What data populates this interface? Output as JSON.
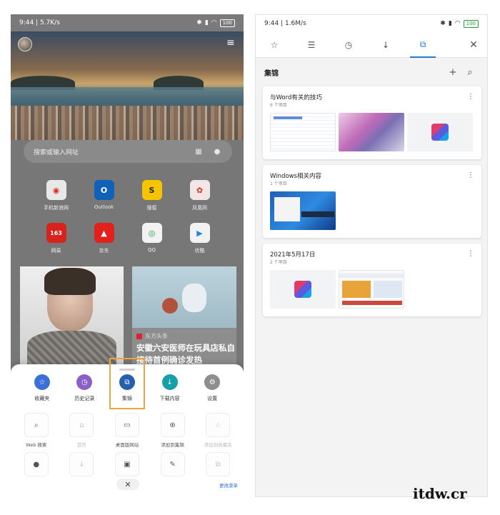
{
  "left_phone": {
    "status": {
      "time_speed": "9:44 | 5.7K/s",
      "battery": "100"
    },
    "search_placeholder": "搜索或输入网址",
    "sites": [
      "手机新浪网",
      "Outlook",
      "搜狐",
      "凤凰网",
      "网易",
      "京东",
      "QQ",
      "优酷"
    ],
    "news": {
      "source": "东方头条",
      "headline": "安徽六安医师在玩具店私自接待首例确诊发热"
    },
    "sheet": {
      "top_actions": [
        "收藏夹",
        "历史记录",
        "集锦",
        "下载内容",
        "设置"
      ],
      "tools": [
        "Web 搜索",
        "首页",
        "桌面版网站",
        "添加到集锦",
        "添加到收藏夹"
      ],
      "tools_row2_icons": [
        "mic-icon",
        "download-icon",
        "collection-add-icon",
        "edit-icon",
        "copy-icon"
      ],
      "close_glyph": "✕",
      "edit_menu": "更改菜单"
    }
  },
  "right_phone": {
    "status": {
      "time_speed": "9:44 | 1.6M/s",
      "battery": "100"
    },
    "tab_icons": [
      "star-icon",
      "reading-list-icon",
      "history-icon",
      "download-icon",
      "collections-icon"
    ],
    "collections_title": "集锦",
    "cards": [
      {
        "title": "与Word有关的技巧",
        "count": "6 个项目"
      },
      {
        "title": "Windows相关内容",
        "count": "1 个项目"
      },
      {
        "title": "2021年5月17日",
        "count": "2 个项目"
      }
    ]
  },
  "watermark": "itdw.cr",
  "accent": {
    "highlight": "#f0a53a",
    "active_tab": "#1f7ad6"
  }
}
